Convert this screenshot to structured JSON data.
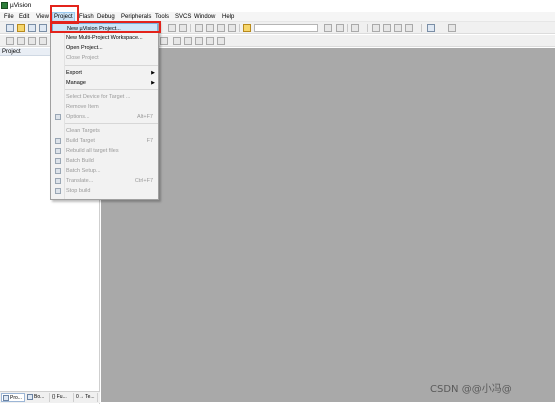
{
  "window": {
    "title": "µVision"
  },
  "menubar": {
    "items": [
      "File",
      "Edit",
      "View",
      "Project",
      "Flash",
      "Debug",
      "Peripherals",
      "Tools",
      "SVCS",
      "Window",
      "Help"
    ],
    "active": "Project"
  },
  "project_panel": {
    "header": "Project",
    "tabs": [
      "Pro...",
      "Bo...",
      "{} Fu...",
      "0→ Te..."
    ]
  },
  "project_menu": {
    "items": [
      {
        "label": "New µVision Project...",
        "shortcut": "",
        "enabled": true,
        "highlighted": true
      },
      {
        "label": "New Multi-Project Workspace...",
        "shortcut": "",
        "enabled": true
      },
      {
        "label": "Open Project...",
        "shortcut": "",
        "enabled": true
      },
      {
        "label": "Close Project",
        "shortcut": "",
        "enabled": false
      },
      {
        "label": "Export",
        "shortcut": "",
        "enabled": true,
        "submenu": true
      },
      {
        "label": "Manage",
        "shortcut": "",
        "enabled": true,
        "submenu": true
      },
      {
        "label": "Select Device for Target ...",
        "shortcut": "",
        "enabled": false
      },
      {
        "label": "Remove Item",
        "shortcut": "",
        "enabled": false
      },
      {
        "label": "Options...",
        "shortcut": "Alt+F7",
        "enabled": false
      },
      {
        "label": "Clean Targets",
        "shortcut": "",
        "enabled": false
      },
      {
        "label": "Build Target",
        "shortcut": "F7",
        "enabled": false
      },
      {
        "label": "Rebuild all target files",
        "shortcut": "",
        "enabled": false
      },
      {
        "label": "Batch Build",
        "shortcut": "",
        "enabled": false
      },
      {
        "label": "Batch Setup...",
        "shortcut": "",
        "enabled": false
      },
      {
        "label": "Translate...",
        "shortcut": "Ctrl+F7",
        "enabled": false
      },
      {
        "label": "Stop build",
        "shortcut": "",
        "enabled": false
      }
    ],
    "submenu_arrow": "▶"
  },
  "colors": {
    "highlight_box": "#e3231b",
    "editor_background": "#a9a9a9",
    "menu_highlight": "#cde6f7"
  },
  "watermark": {
    "text": "CSDN @@小冯@"
  }
}
